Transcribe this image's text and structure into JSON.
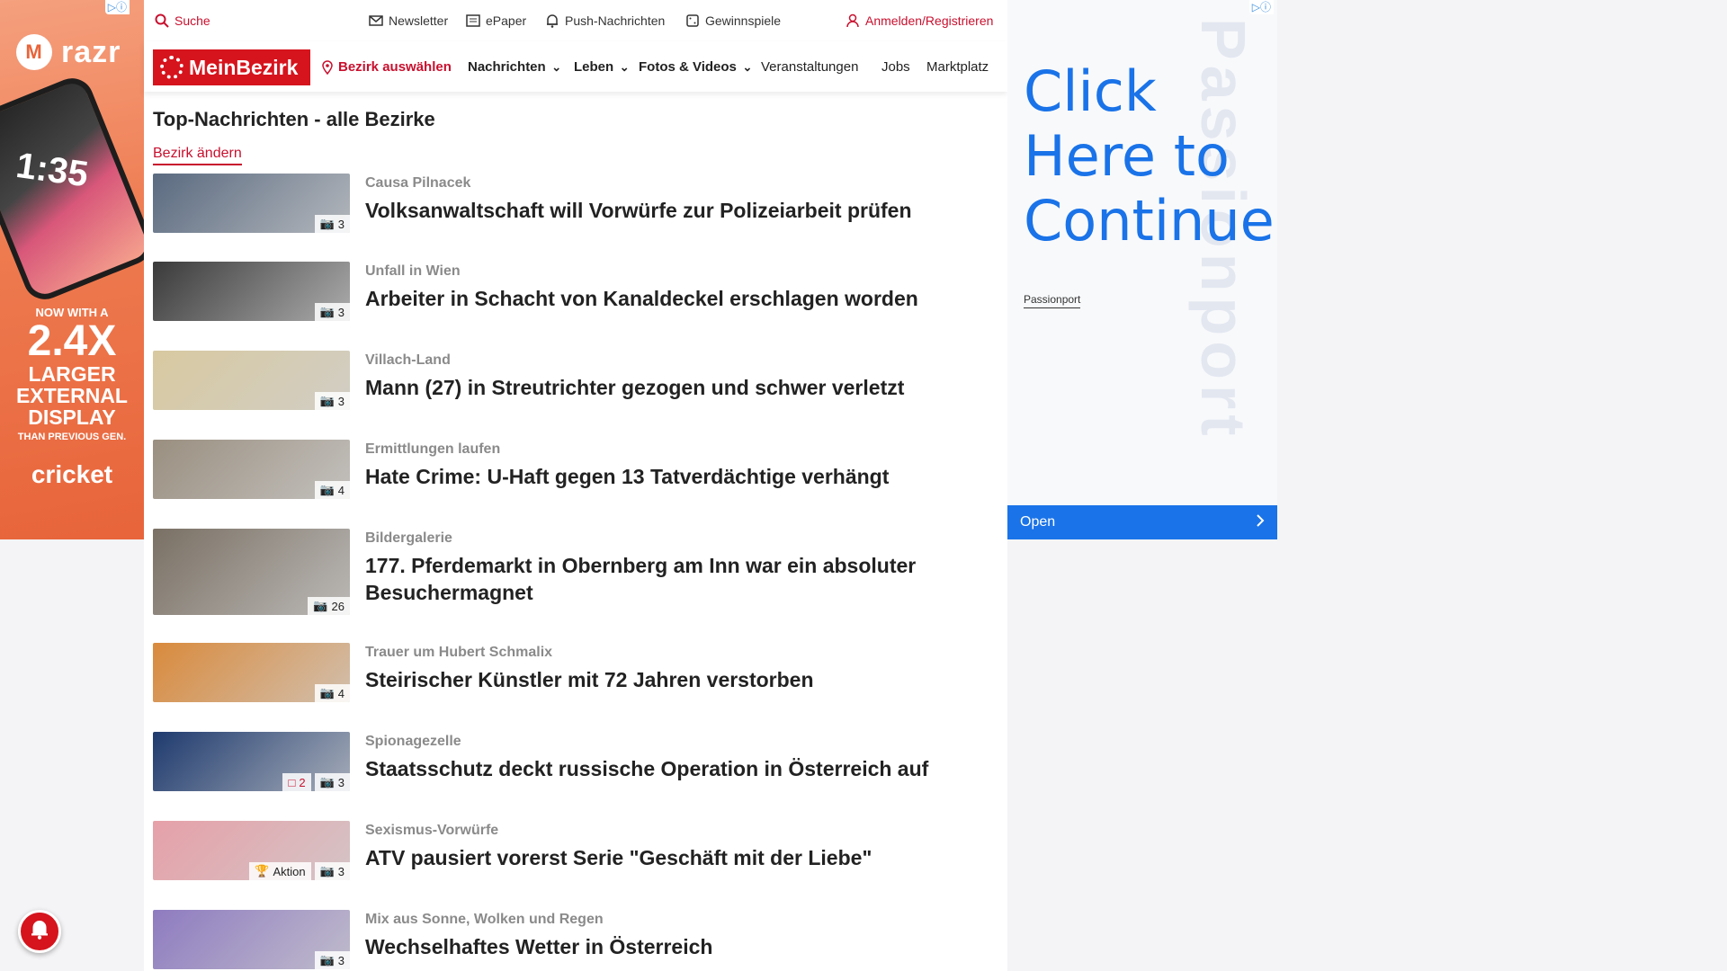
{
  "left_ad": {
    "adchoices": "▷ⓘ",
    "brand": "razr",
    "phone_time": "1:35",
    "line1": "NOW WITH A",
    "line2": "2.4X",
    "line3": "LARGER",
    "line4": "EXTERNAL",
    "line5": "DISPLAY",
    "line6": "THAN PREVIOUS GEN.",
    "sponsor": "cricket"
  },
  "utility": {
    "search": "Suche",
    "newsletter": "Newsletter",
    "epaper": "ePaper",
    "push": "Push-Nachrichten",
    "games": "Gewinnspiele",
    "login": "Anmelden/Registrieren"
  },
  "nav": {
    "logo": "MeinBezirk",
    "district": "Bezirk auswählen",
    "items": [
      "Nachrichten",
      "Leben",
      "Fotos & Videos",
      "Veranstaltungen",
      "Jobs",
      "Marktplatz"
    ]
  },
  "main": {
    "heading": "Top-Nachrichten - alle Bezirke",
    "change_district": "Bezirk ändern"
  },
  "articles": [
    {
      "kicker": "Causa Pilnacek",
      "title": "Volksanwaltschaft will Vorwürfe zur Polizeiarbeit prüfen",
      "images": "3",
      "comments": "",
      "action": "",
      "thumb": "#5a6a80"
    },
    {
      "kicker": "Unfall in Wien",
      "title": "Arbeiter in Schacht von Kanaldeckel erschlagen worden",
      "images": "3",
      "comments": "",
      "action": "",
      "thumb": "#3a3a3a"
    },
    {
      "kicker": "Villach-Land",
      "title": "Mann (27) in Streutrichter gezogen und schwer verletzt",
      "images": "3",
      "comments": "",
      "action": "",
      "thumb": "#d8c9a0"
    },
    {
      "kicker": "Ermittlungen laufen",
      "title": "Hate Crime: U-Haft gegen 13 Tatverdächtige verhängt",
      "images": "4",
      "comments": "",
      "action": "",
      "thumb": "#9a8f80"
    },
    {
      "kicker": "Bildergalerie",
      "title": "177. Pferdemarkt in Obernberg am Inn war ein absoluter Besuchermagnet",
      "images": "26",
      "comments": "",
      "action": "",
      "thumb": "#7a7064"
    },
    {
      "kicker": "Trauer um Hubert Schmalix",
      "title": "Steirischer Künstler mit 72 Jahren verstorben",
      "images": "4",
      "comments": "",
      "action": "",
      "thumb": "#d98a3c"
    },
    {
      "kicker": "Spionagezelle",
      "title": "Staatsschutz deckt russische Operation in Österreich auf",
      "images": "3",
      "comments": "2",
      "action": "",
      "thumb": "#1e3a6e"
    },
    {
      "kicker": "Sexismus-Vorwürfe",
      "title": "ATV pausiert vorerst Serie \"Geschäft mit der Liebe\"",
      "images": "3",
      "comments": "",
      "action": "Aktion",
      "thumb": "#e6a0a8"
    },
    {
      "kicker": "Mix aus Sonne, Wolken und Regen",
      "title": "Wechselhaftes Wetter in Österreich",
      "images": "3",
      "comments": "",
      "action": "",
      "thumb": "#8e7bc0"
    }
  ],
  "right_ad": {
    "adchoices": "▷ⓘ",
    "headline": "Click Here to Continue",
    "sponsor": "Passionport",
    "watermark": "Passionport",
    "button": "Open"
  }
}
